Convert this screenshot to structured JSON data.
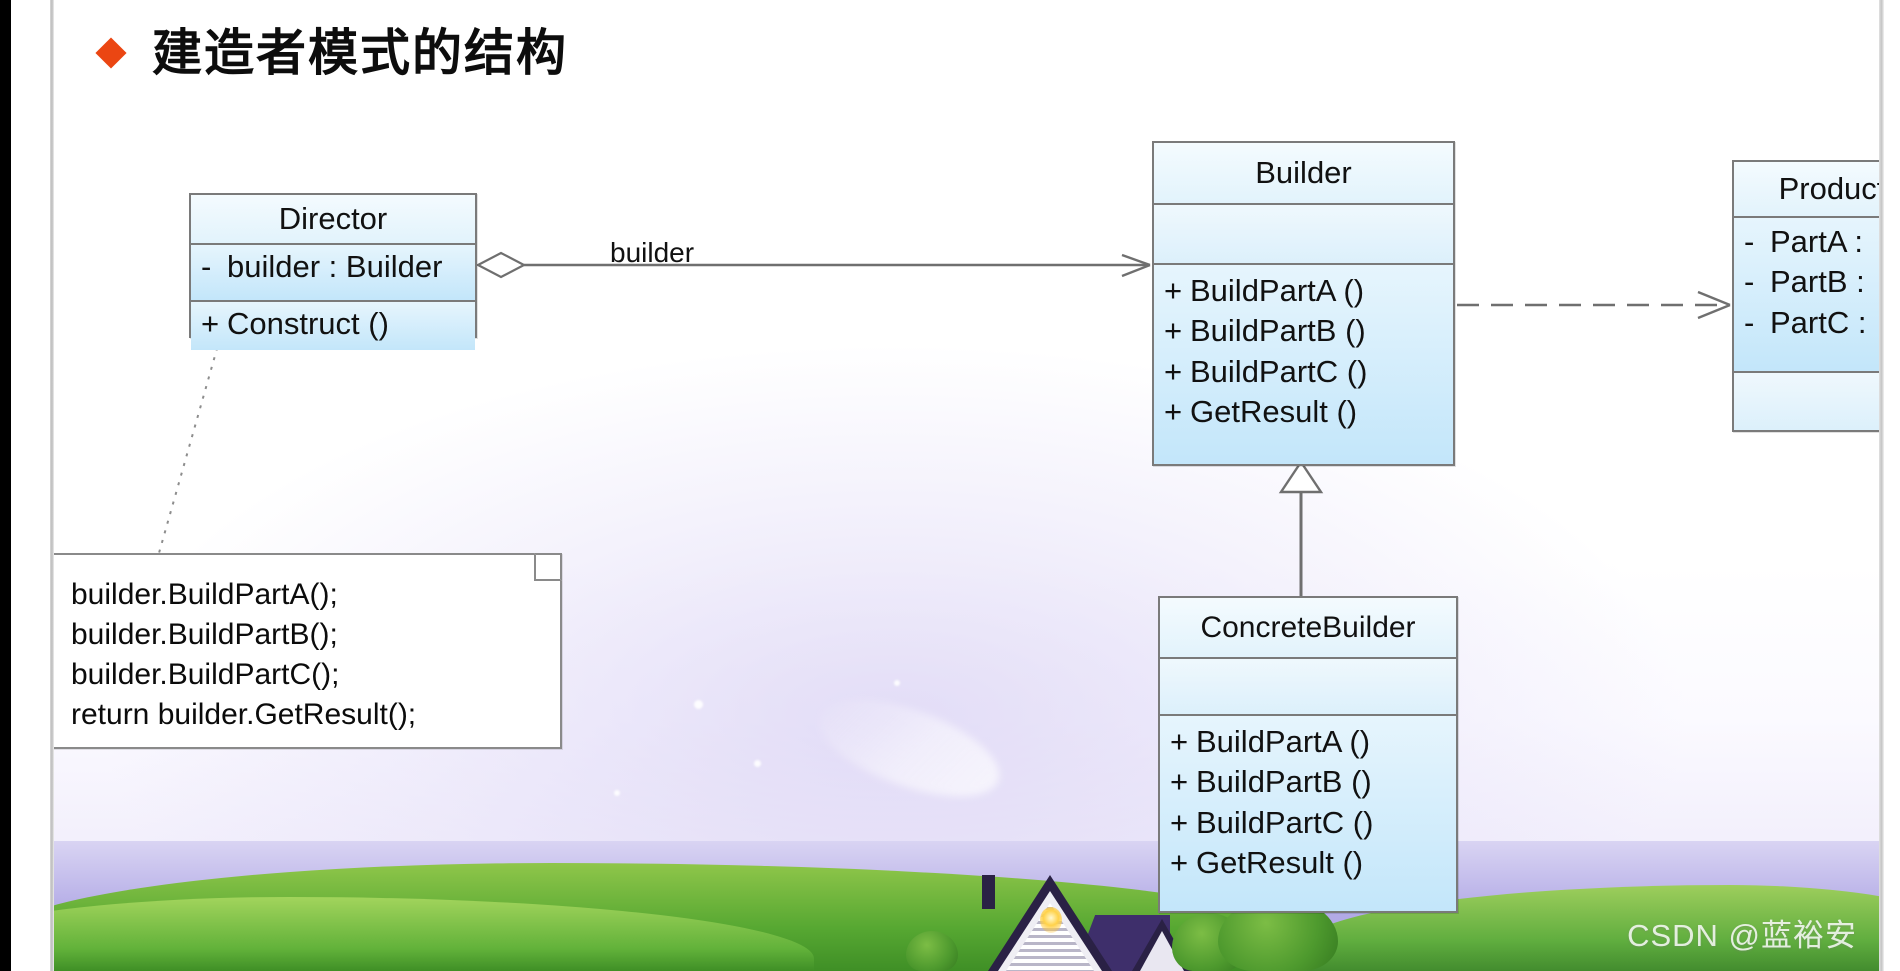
{
  "slide": {
    "title": "建造者模式的结构",
    "bullet_icon": "diamond-bullet-icon",
    "bullet_color": "#eb4612",
    "accent_box_fill": "#cdeafb",
    "box_border_color": "#7a7a7a"
  },
  "classes": {
    "director": {
      "name": "Director",
      "attributes": [
        {
          "visibility": "-",
          "text": "builder : Builder"
        }
      ],
      "operations": [
        {
          "visibility": "+",
          "text": "Construct ()"
        }
      ]
    },
    "builder": {
      "name": "Builder",
      "attributes": [],
      "operations": [
        {
          "visibility": "+",
          "text": "BuildPartA ()"
        },
        {
          "visibility": "+",
          "text": "BuildPartB ()"
        },
        {
          "visibility": "+",
          "text": "BuildPartC ()"
        },
        {
          "visibility": "+",
          "text": "GetResult ()"
        }
      ]
    },
    "concrete_builder": {
      "name": "ConcreteBuilder",
      "attributes": [],
      "operations": [
        {
          "visibility": "+",
          "text": "BuildPartA ()"
        },
        {
          "visibility": "+",
          "text": "BuildPartB ()"
        },
        {
          "visibility": "+",
          "text": "BuildPartC ()"
        },
        {
          "visibility": "+",
          "text": "GetResult ()"
        }
      ]
    },
    "product": {
      "name": "Product",
      "attributes": [
        {
          "visibility": "-",
          "text": "PartA :"
        },
        {
          "visibility": "-",
          "text": "PartB :"
        },
        {
          "visibility": "-",
          "text": "PartC :"
        }
      ],
      "operations": []
    }
  },
  "relationships": {
    "aggregation": {
      "label": "builder",
      "from": "Director",
      "to": "Builder",
      "kind": "aggregation"
    },
    "dependency": {
      "from": "Builder",
      "to": "Product",
      "kind": "dependency"
    },
    "generalization": {
      "from": "ConcreteBuilder",
      "to": "Builder",
      "kind": "generalization"
    },
    "note_link": {
      "from": "Director",
      "to": "note",
      "kind": "note-anchor"
    }
  },
  "note": {
    "lines": [
      "builder.BuildPartA();",
      "builder.BuildPartB();",
      "builder.BuildPartC();",
      "return builder.GetResult();"
    ]
  },
  "watermark": {
    "text": "CSDN @蓝裕安"
  }
}
